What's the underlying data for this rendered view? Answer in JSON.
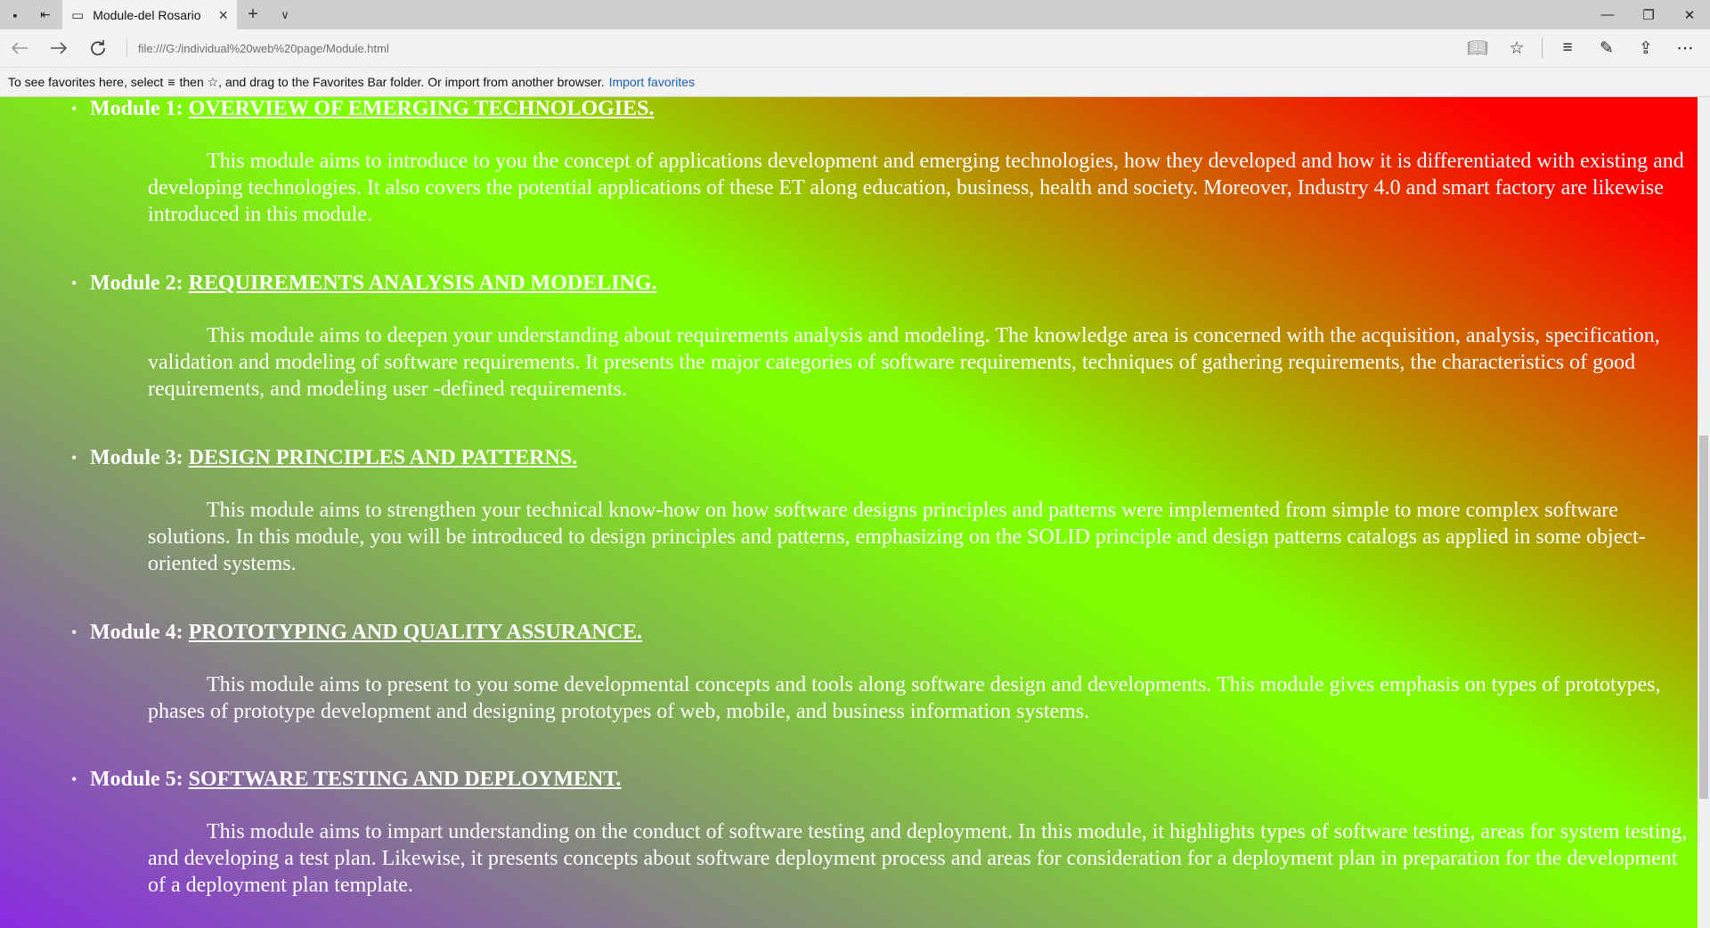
{
  "browser": {
    "tab_title": "Module-del Rosario",
    "tab_close_glyph": "×",
    "new_tab_glyph": "+",
    "tab_list_glyph": "∨",
    "url": "file:///G:/individual%20web%20page/Module.html",
    "window_controls": {
      "minimize": "—",
      "restore": "❐",
      "close": "✕"
    }
  },
  "favorites_bar": {
    "text_before": "To see favorites here, select",
    "text_middle": "then ☆, and drag to the Favorites Bar folder. Or import from another browser.",
    "link": "Import favorites"
  },
  "modules": [
    {
      "label": "Module 1:",
      "title": "OVERVIEW OF EMERGING TECHNOLOGIES.",
      "description": "This module aims to introduce to you the concept of applications development and emerging technologies, how they developed and how it is differentiated with existing and developing technologies. It also covers the potential applications of these ET along education, business, health and society. Moreover, Industry 4.0 and smart factory are likewise introduced in this module."
    },
    {
      "label": "Module 2:",
      "title": "REQUIREMENTS ANALYSIS AND MODELING.",
      "description": "This module aims to deepen your understanding about requirements analysis and modeling. The knowledge area is concerned with the acquisition, analysis, specification, validation and modeling of software requirements. It presents the major categories of software requirements, techniques of gathering requirements, the characteristics of good requirements, and modeling user -defined requirements."
    },
    {
      "label": "Module 3:",
      "title": "DESIGN PRINCIPLES AND PATTERNS.",
      "description": "This module aims to strengthen your technical know-how on how software designs principles and patterns were implemented from simple to more complex software solutions. In this module, you will be introduced to design principles and patterns, emphasizing on the SOLID principle and design patterns catalogs as applied in some object-oriented systems."
    },
    {
      "label": "Module 4:",
      "title": "PROTOTYPING AND QUALITY ASSURANCE.",
      "description": "This module aims to present to you some developmental concepts and tools along software design and developments. This module gives emphasis on types of prototypes, phases of prototype development and designing prototypes of web, mobile, and business information systems."
    },
    {
      "label": "Module 5:",
      "title": "SOFTWARE TESTING AND DEPLOYMENT.",
      "description": "This module aims to impart understanding on the conduct of software testing and deployment. In this module, it highlights types of software testing, areas for system testing, and developing a test plan. Likewise, it presents concepts about software deployment process and areas for consideration for a deployment plan in preparation for the development of a deployment plan template."
    }
  ]
}
